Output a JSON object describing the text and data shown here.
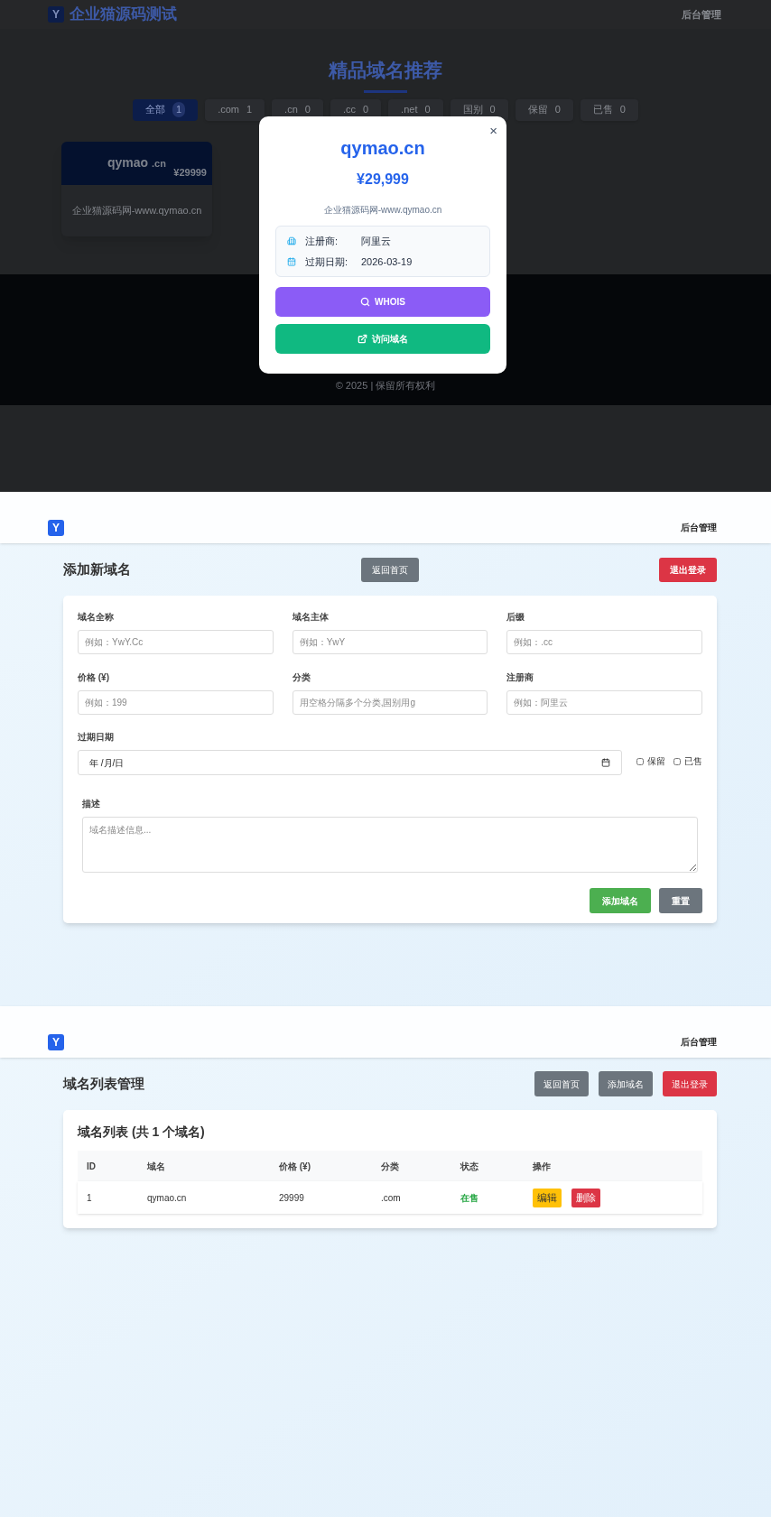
{
  "home": {
    "header": {
      "logo": "Y",
      "title": "企业猫源码测试",
      "nav": "后台管理"
    },
    "heading": "精品域名推荐",
    "filters": [
      {
        "label": "全部",
        "count": "1",
        "selected": true
      },
      {
        "label": ".com",
        "count": "1",
        "selected": false
      },
      {
        "label": ".cn",
        "count": "0",
        "selected": false
      },
      {
        "label": ".cc",
        "count": "0",
        "selected": false
      },
      {
        "label": ".net",
        "count": "0",
        "selected": false
      },
      {
        "label": "国别",
        "count": "0",
        "selected": false
      },
      {
        "label": "保留",
        "count": "0",
        "selected": false
      },
      {
        "label": "已售",
        "count": "0",
        "selected": false
      }
    ],
    "cards": [
      {
        "name": "qymao",
        "suffix": ".cn",
        "price": "¥29999",
        "description": "企业猫源码网-www.qymao.cn"
      }
    ],
    "footer": "© 2025 | 保留所有权利",
    "modal": {
      "close": "×",
      "title": "qymao.cn",
      "price": "¥29,999",
      "description": "企业猫源码网-www.qymao.cn",
      "info": [
        {
          "kind": "registrar",
          "label": "注册商:",
          "value": "阿里云"
        },
        {
          "kind": "expiry",
          "label": "过期日期:",
          "value": "2026-03-19"
        }
      ],
      "buttons": [
        {
          "kind": "whois",
          "label": "WHOIS"
        },
        {
          "kind": "visit",
          "label": "访问域名"
        }
      ]
    }
  },
  "add_form": {
    "header": {
      "logo": "Y",
      "nav": "后台管理"
    },
    "title": "添加新域名",
    "buttons": [
      {
        "kind": "secondary",
        "label": "返回首页"
      },
      {
        "kind": "danger",
        "label": "退出登录"
      }
    ],
    "fields": [
      {
        "label": "域名全称",
        "placeholder": "例如：YwY.Cc"
      },
      {
        "label": "域名主体",
        "placeholder": "例如：YwY"
      },
      {
        "label": "后缀",
        "placeholder": "例如：.cc"
      },
      {
        "label": "价格 (¥)",
        "placeholder": "例如：199"
      },
      {
        "label": "分类",
        "placeholder": "用空格分隔多个分类,国别用g"
      },
      {
        "label": "注册商",
        "placeholder": "例如：阿里云"
      }
    ],
    "date": {
      "label": "过期日期",
      "placeholder": "年 /月/日"
    },
    "checkboxes": [
      {
        "label": "保留",
        "checked": false
      },
      {
        "label": "已售",
        "checked": false
      }
    ],
    "description": {
      "label": "描述",
      "placeholder": "域名描述信息..."
    },
    "actions": [
      {
        "kind": "success",
        "label": "添加域名"
      },
      {
        "kind": "secondary",
        "label": "重置"
      }
    ]
  },
  "list": {
    "header": {
      "logo": "Y",
      "nav": "后台管理"
    },
    "title": "域名列表管理",
    "buttons": [
      {
        "kind": "secondary",
        "label": "返回首页"
      },
      {
        "kind": "secondary",
        "label": "添加域名"
      },
      {
        "kind": "danger",
        "label": "退出登录"
      }
    ],
    "table_title": "域名列表 (共 1 个域名)",
    "columns": [
      "ID",
      "域名",
      "价格 (¥)",
      "分类",
      "状态",
      "操作"
    ],
    "rows": [
      {
        "id": "1",
        "domain": "qymao.cn",
        "price": "29999",
        "category": ".com",
        "status": "在售",
        "actions": [
          {
            "kind": "warning",
            "label": "编辑"
          },
          {
            "kind": "danger",
            "label": "删除"
          }
        ]
      }
    ]
  }
}
